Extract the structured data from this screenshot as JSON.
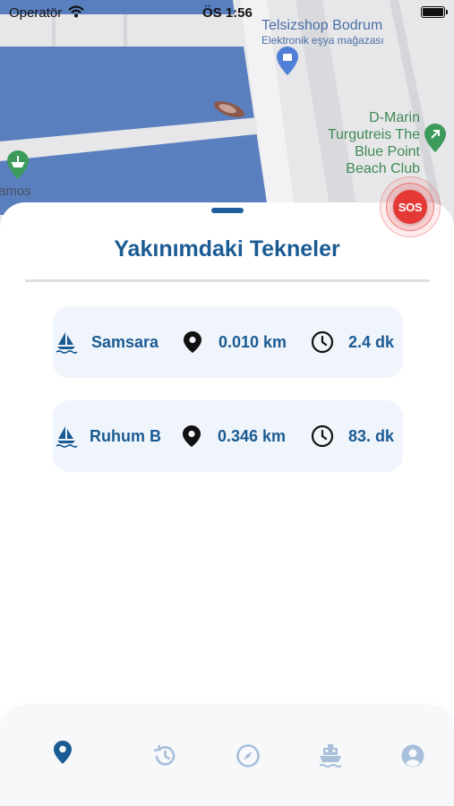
{
  "status_bar": {
    "carrier": "Operatör",
    "time": "ÖS 1:56"
  },
  "map": {
    "labels": {
      "shop_name": "Telsizshop Bodrum",
      "shop_category": "Elektronik eşya mağazası",
      "marina_line1": "D-Marin",
      "marina_line2": "Turgutreis The",
      "marina_line3": "Blue Point",
      "marina_line4": "Beach Club",
      "left_edge_label": "amos"
    },
    "colors": {
      "water": "#5a7fbf",
      "land": "#e7e7e9"
    }
  },
  "sos_button": {
    "label": "SOS",
    "color": "#e53935"
  },
  "sheet": {
    "title": "Yakınımdaki Tekneler",
    "boats": [
      {
        "name": "Samsara",
        "distance": "0.010 km",
        "eta": "2.4 dk"
      },
      {
        "name": "Ruhum B",
        "distance": "0.346 km",
        "eta": "83. dk"
      }
    ],
    "icons": {
      "boat": "sailboat-icon",
      "distance": "location-pin-icon",
      "eta": "clock-icon"
    }
  },
  "bottom_nav": {
    "active_index": 0,
    "items": [
      {
        "icon": "map-pin-icon",
        "active": true
      },
      {
        "icon": "history-icon",
        "active": false
      },
      {
        "icon": "compass-icon",
        "active": false
      },
      {
        "icon": "ferry-icon",
        "active": false
      },
      {
        "icon": "profile-icon",
        "active": false
      }
    ],
    "colors": {
      "active": "#1a5b93",
      "inactive": "#a8bfd9"
    }
  }
}
